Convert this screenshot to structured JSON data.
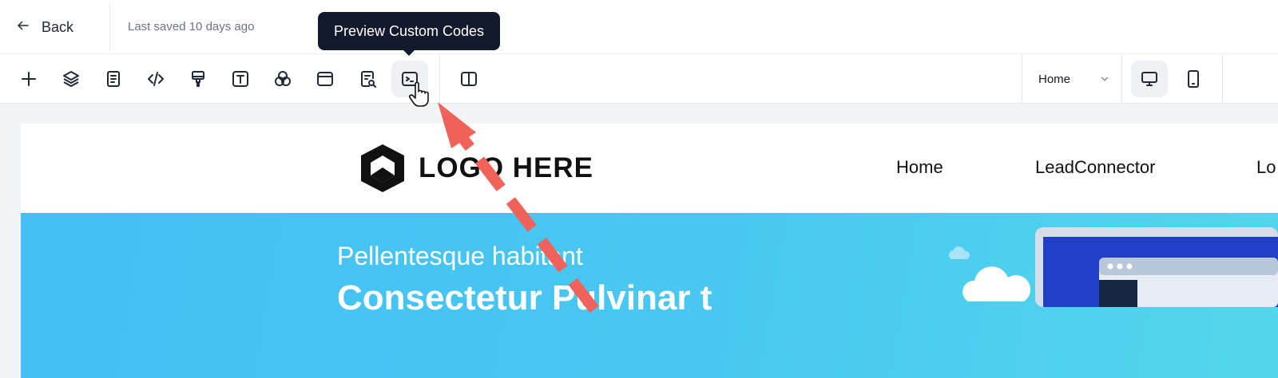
{
  "topbar": {
    "back_label": "Back",
    "saved_text": "Last saved 10 days ago"
  },
  "toolbar": {
    "tools": [
      {
        "icon": "plus-icon"
      },
      {
        "icon": "layers-icon"
      },
      {
        "icon": "page-icon"
      },
      {
        "icon": "code-icon"
      },
      {
        "icon": "paint-brush-icon"
      },
      {
        "icon": "text-icon"
      },
      {
        "icon": "color-circles-icon"
      },
      {
        "icon": "layout-icon"
      },
      {
        "icon": "seo-search-icon"
      },
      {
        "icon": "terminal-icon",
        "active": true
      },
      {
        "icon": "split-view-icon"
      }
    ],
    "tooltip": "Preview Custom Codes",
    "page_selected": "Home",
    "device_active": "desktop"
  },
  "site": {
    "logo_text": "LOGO HERE",
    "nav": [
      "Home",
      "LeadConnector",
      "Lo"
    ],
    "hero_subtitle": "Pellentesque habitant",
    "hero_title": "Consectetur Pulvinar t"
  },
  "colors": {
    "tooltip_bg": "#131a2b",
    "hero_gradient_start": "#44bff6",
    "hero_gradient_end": "#52d6ec",
    "annotation_arrow": "#f0625a"
  }
}
